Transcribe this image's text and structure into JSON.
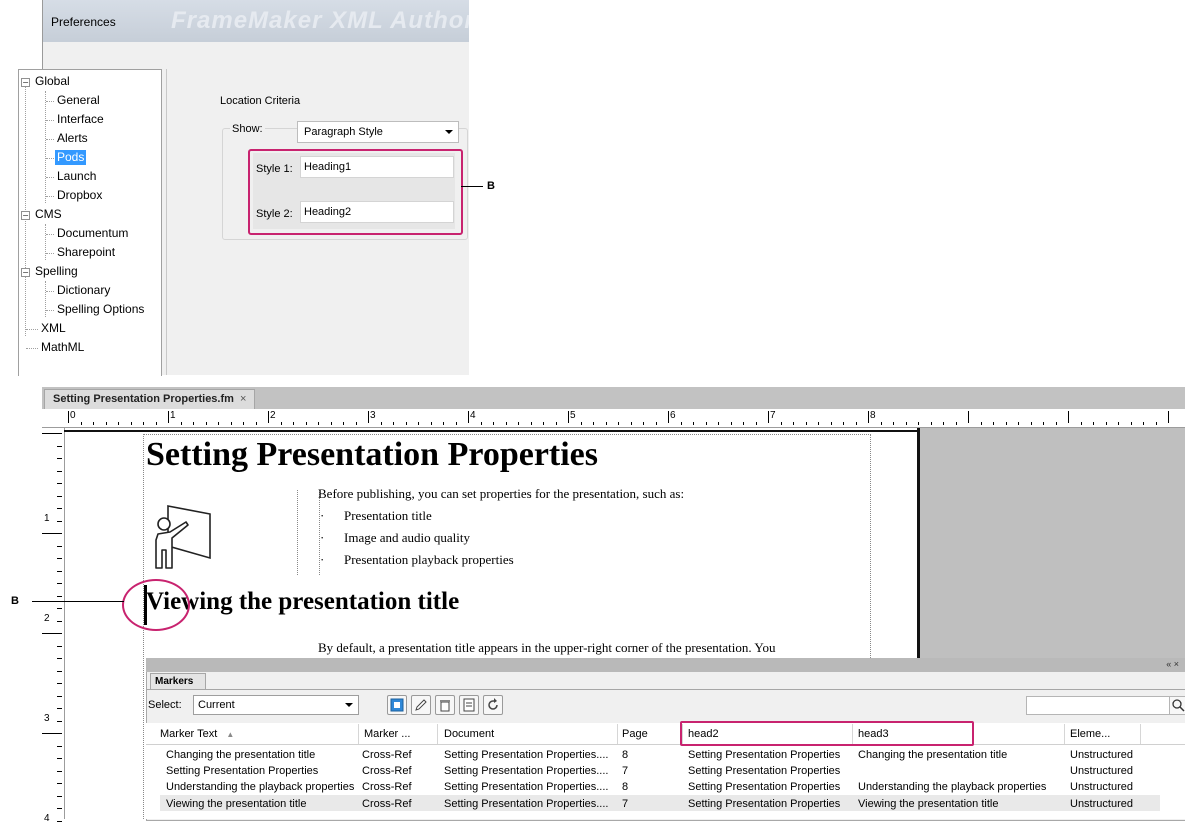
{
  "preferences": {
    "title": "Preferences",
    "ghost_title": "FrameMaker XML Author",
    "tree": [
      {
        "label": "Global",
        "level": 0
      },
      {
        "label": "General",
        "level": 1
      },
      {
        "label": "Interface",
        "level": 1
      },
      {
        "label": "Alerts",
        "level": 1
      },
      {
        "label": "Pods",
        "level": 1,
        "selected": true
      },
      {
        "label": "Launch",
        "level": 1
      },
      {
        "label": "Dropbox",
        "level": 1
      },
      {
        "label": "CMS",
        "level": 0
      },
      {
        "label": "Documentum",
        "level": 1
      },
      {
        "label": "Sharepoint",
        "level": 1
      },
      {
        "label": "Spelling",
        "level": 0
      },
      {
        "label": "Dictionary",
        "level": 1
      },
      {
        "label": "Spelling Options",
        "level": 1
      },
      {
        "label": "XML",
        "level": 0
      },
      {
        "label": "MathML",
        "level": 0
      }
    ],
    "location_criteria_label": "Location Criteria",
    "show_label": "Show:",
    "show_value": "Paragraph Style",
    "style1_label": "Style 1:",
    "style1_value": "Heading1",
    "style2_label": "Style 2:",
    "style2_value": "Heading2"
  },
  "callout_label": "B",
  "document": {
    "tab_title": "Setting Presentation Properties.fm",
    "tab_close": "×",
    "ruler_top_numbers": [
      "0",
      "1",
      "2",
      "3",
      "4",
      "5",
      "6",
      "7",
      "8"
    ],
    "ruler_left_numbers": [
      "1",
      "2",
      "3",
      "4"
    ],
    "heading1": "Setting Presentation Properties",
    "intro": "Before publishing, you can set properties for the presentation, such as:",
    "bullets": [
      "Presentation title",
      "Image and audio quality",
      "Presentation playback properties"
    ],
    "bullet_glyph": "·",
    "heading2": "Viewing the presentation title",
    "paragraph": "By default, a presentation title appears in the upper-right corner of the presentation. You"
  },
  "markers_pod": {
    "header_controls": "«  ×",
    "tab_label": "Markers",
    "select_label": "Select:",
    "select_value": "Current",
    "toolbar_icons": [
      "new-marker-icon",
      "edit-marker-icon",
      "delete-marker-icon",
      "export-icon",
      "refresh-icon"
    ],
    "columns": [
      "Marker Text",
      "Marker ...",
      "Document",
      "Page",
      "head2",
      "head3",
      "Eleme..."
    ],
    "sort_indicator": "▲",
    "rows": [
      [
        "Changing the presentation title",
        "Cross-Ref",
        "Setting Presentation Properties....",
        "8",
        "Setting Presentation Properties",
        "Changing the presentation title",
        "Unstructured"
      ],
      [
        "Setting Presentation Properties",
        "Cross-Ref",
        "Setting Presentation Properties....",
        "7",
        "Setting Presentation Properties",
        "",
        "Unstructured"
      ],
      [
        "Understanding the playback properties",
        "Cross-Ref",
        "Setting Presentation Properties....",
        "8",
        "Setting Presentation Properties",
        "Understanding the playback properties",
        "Unstructured"
      ],
      [
        "Viewing the presentation title",
        "Cross-Ref",
        "Setting Presentation Properties....",
        "7",
        "Setting Presentation Properties",
        "Viewing the presentation title",
        "Unstructured"
      ]
    ]
  }
}
